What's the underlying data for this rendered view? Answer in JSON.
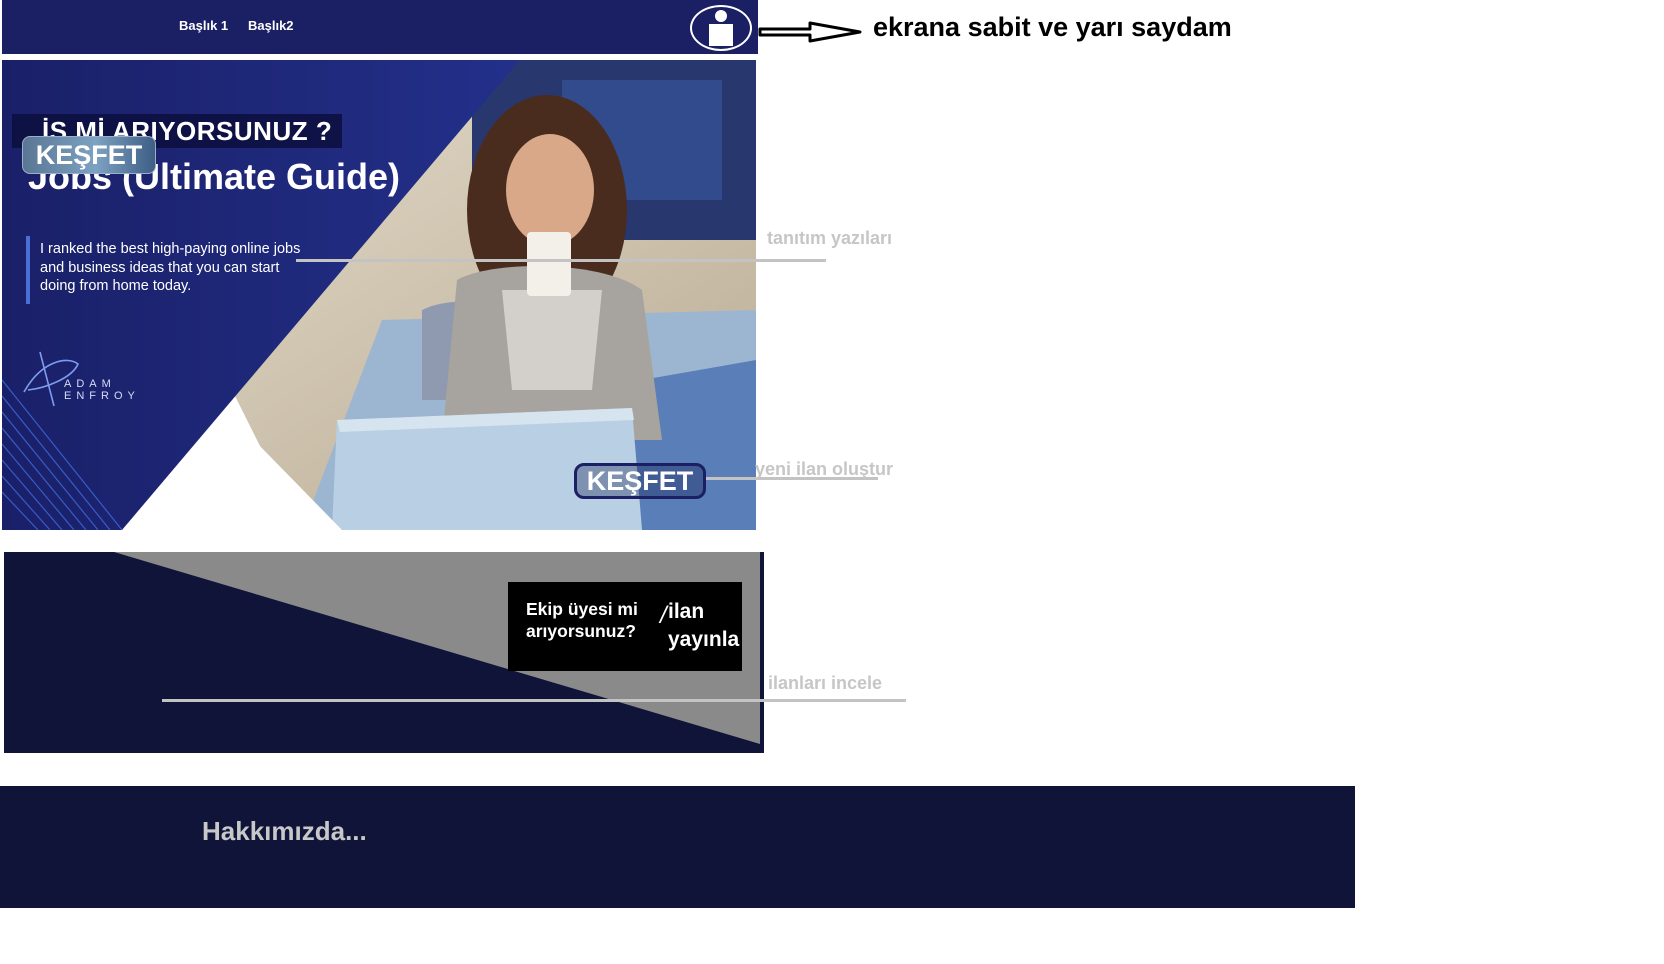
{
  "nav": {
    "links": [
      "Başlık 1",
      "Başlık2"
    ],
    "avatar_icon": "user-icon"
  },
  "hero": {
    "question": "İŞ Mİ ARIYORSUNUZ ?",
    "title": "Jobs (Ultimate Guide)",
    "description": "I ranked the best high-paying online jobs and business ideas that you can start doing from home today.",
    "logo_text": "ADAM ENFROY",
    "button_label": "KEŞFET"
  },
  "mid": {
    "box_question": "Ekip üyesi mi arıyorsunuz?",
    "box_slash": "/",
    "box_action": "ilan yayınla",
    "button_label": "KEŞFET"
  },
  "footer": {
    "about": "Hakkımızda..."
  },
  "annotations": {
    "fixed_header": "ekrana sabit ve yarı saydam",
    "intro_text": "tanıtım yazıları",
    "new_listing": "yeni ilan oluştur",
    "review_listings": "ilanları incele"
  },
  "colors": {
    "nav_bg": "#1a2063",
    "section_bg": "#0f1438",
    "annotation_grey": "#c3c3c3"
  }
}
